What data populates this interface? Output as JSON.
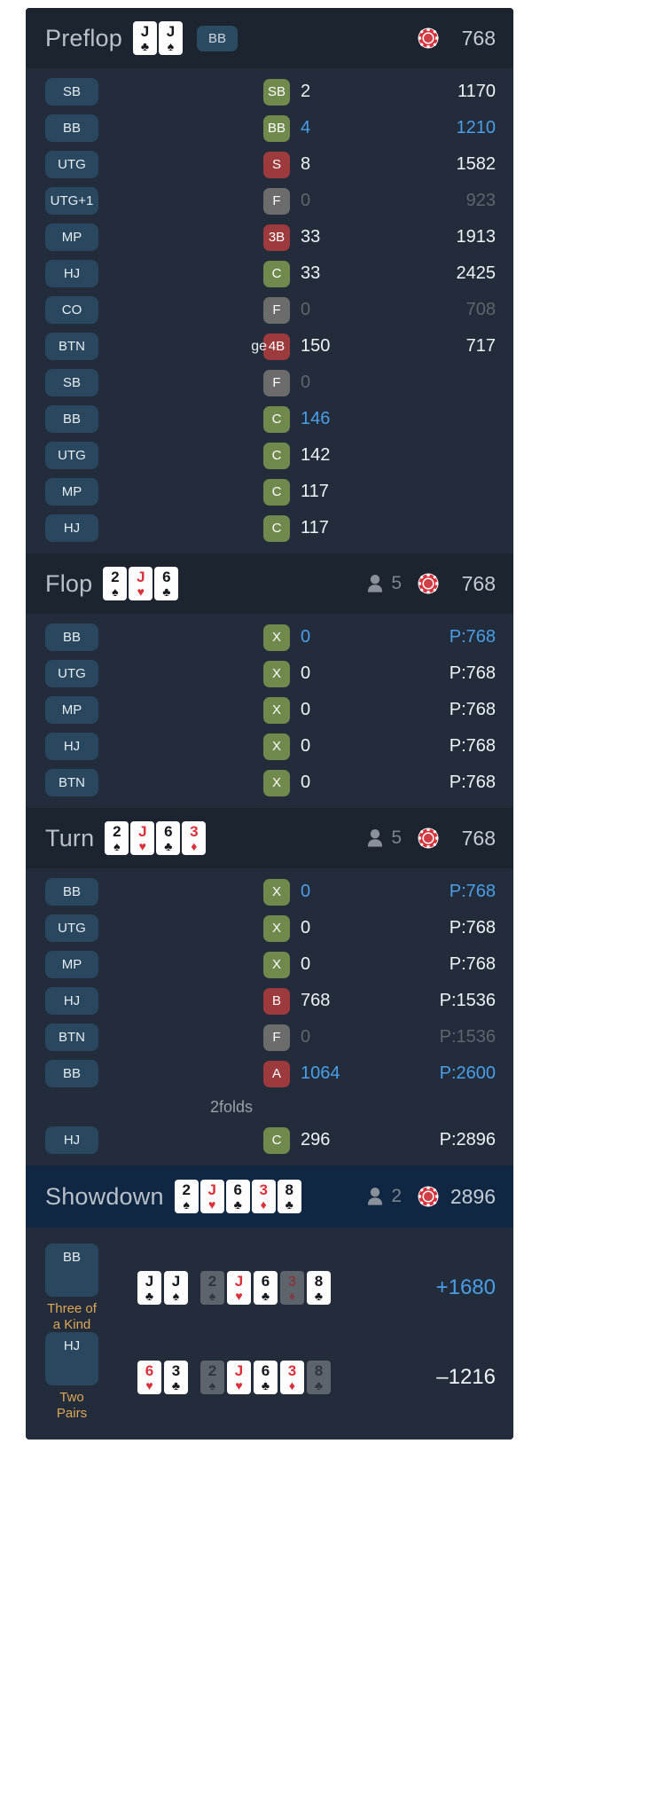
{
  "icons": {
    "chip": "poker-chip-icon",
    "person": "person-icon"
  },
  "streets": [
    {
      "id": "preflop",
      "title": "Preflop",
      "cards": [
        {
          "rank": "J",
          "suit": "♣",
          "color": "black"
        },
        {
          "rank": "J",
          "suit": "♠",
          "color": "black"
        }
      ],
      "hero_tag": "BB",
      "players": null,
      "pot": "768",
      "actions": [
        {
          "pos": "SB",
          "note": "",
          "act": "SB",
          "act_type": "call",
          "amount": "2",
          "stack": "1170",
          "hero": false,
          "folded": false
        },
        {
          "pos": "BB",
          "note": "",
          "act": "BB",
          "act_type": "call",
          "amount": "4",
          "stack": "1210",
          "hero": true,
          "folded": false
        },
        {
          "pos": "UTG",
          "note": "",
          "act": "S",
          "act_type": "raise",
          "amount": "8",
          "stack": "1582",
          "hero": false,
          "folded": false
        },
        {
          "pos": "UTG+1",
          "note": "",
          "act": "F",
          "act_type": "fold",
          "amount": "0",
          "stack": "923",
          "hero": false,
          "folded": true
        },
        {
          "pos": "MP",
          "note": "",
          "act": "3B",
          "act_type": "raise",
          "amount": "33",
          "stack": "1913",
          "hero": false,
          "folded": false
        },
        {
          "pos": "HJ",
          "note": "",
          "act": "C",
          "act_type": "call",
          "amount": "33",
          "stack": "2425",
          "hero": false,
          "folded": false
        },
        {
          "pos": "CO",
          "note": "",
          "act": "F",
          "act_type": "fold",
          "amount": "0",
          "stack": "708",
          "hero": false,
          "folded": true
        },
        {
          "pos": "BTN",
          "note": "ge",
          "act": "4B",
          "act_type": "raise",
          "amount": "150",
          "stack": "717",
          "hero": false,
          "folded": false
        },
        {
          "pos": "SB",
          "note": "",
          "act": "F",
          "act_type": "fold",
          "amount": "0",
          "stack": "",
          "hero": false,
          "folded": true
        },
        {
          "pos": "BB",
          "note": "",
          "act": "C",
          "act_type": "call",
          "amount": "146",
          "stack": "",
          "hero": true,
          "folded": false
        },
        {
          "pos": "UTG",
          "note": "",
          "act": "C",
          "act_type": "call",
          "amount": "142",
          "stack": "",
          "hero": false,
          "folded": false
        },
        {
          "pos": "MP",
          "note": "",
          "act": "C",
          "act_type": "call",
          "amount": "117",
          "stack": "",
          "hero": false,
          "folded": false
        },
        {
          "pos": "HJ",
          "note": "",
          "act": "C",
          "act_type": "call",
          "amount": "117",
          "stack": "",
          "hero": false,
          "folded": false
        }
      ],
      "folds_note": ""
    },
    {
      "id": "flop",
      "title": "Flop",
      "cards": [
        {
          "rank": "2",
          "suit": "♠",
          "color": "black"
        },
        {
          "rank": "J",
          "suit": "♥",
          "color": "red"
        },
        {
          "rank": "6",
          "suit": "♣",
          "color": "black"
        }
      ],
      "hero_tag": "",
      "players": "5",
      "pot": "768",
      "actions": [
        {
          "pos": "BB",
          "note": "",
          "act": "X",
          "act_type": "call",
          "amount": "0",
          "stack": "P:768",
          "hero": true,
          "folded": false
        },
        {
          "pos": "UTG",
          "note": "",
          "act": "X",
          "act_type": "call",
          "amount": "0",
          "stack": "P:768",
          "hero": false,
          "folded": false
        },
        {
          "pos": "MP",
          "note": "",
          "act": "X",
          "act_type": "call",
          "amount": "0",
          "stack": "P:768",
          "hero": false,
          "folded": false
        },
        {
          "pos": "HJ",
          "note": "",
          "act": "X",
          "act_type": "call",
          "amount": "0",
          "stack": "P:768",
          "hero": false,
          "folded": false
        },
        {
          "pos": "BTN",
          "note": "",
          "act": "X",
          "act_type": "call",
          "amount": "0",
          "stack": "P:768",
          "hero": false,
          "folded": false
        }
      ],
      "folds_note": ""
    },
    {
      "id": "turn",
      "title": "Turn",
      "cards": [
        {
          "rank": "2",
          "suit": "♠",
          "color": "black"
        },
        {
          "rank": "J",
          "suit": "♥",
          "color": "red"
        },
        {
          "rank": "6",
          "suit": "♣",
          "color": "black"
        },
        {
          "rank": "3",
          "suit": "♦",
          "color": "red"
        }
      ],
      "hero_tag": "",
      "players": "5",
      "pot": "768",
      "actions": [
        {
          "pos": "BB",
          "note": "",
          "act": "X",
          "act_type": "call",
          "amount": "0",
          "stack": "P:768",
          "hero": true,
          "folded": false
        },
        {
          "pos": "UTG",
          "note": "",
          "act": "X",
          "act_type": "call",
          "amount": "0",
          "stack": "P:768",
          "hero": false,
          "folded": false
        },
        {
          "pos": "MP",
          "note": "",
          "act": "X",
          "act_type": "call",
          "amount": "0",
          "stack": "P:768",
          "hero": false,
          "folded": false
        },
        {
          "pos": "HJ",
          "note": "",
          "act": "B",
          "act_type": "raise",
          "amount": "768",
          "stack": "P:1536",
          "hero": false,
          "folded": false
        },
        {
          "pos": "BTN",
          "note": "",
          "act": "F",
          "act_type": "fold",
          "amount": "0",
          "stack": "P:1536",
          "hero": false,
          "folded": true
        },
        {
          "pos": "BB",
          "note": "",
          "act": "A",
          "act_type": "raise",
          "amount": "1064",
          "stack": "P:2600",
          "hero": true,
          "folded": false
        }
      ],
      "folds_note": "2folds",
      "actions_after_note": [
        {
          "pos": "HJ",
          "note": "",
          "act": "C",
          "act_type": "call",
          "amount": "296",
          "stack": "P:2896",
          "hero": false,
          "folded": false
        }
      ]
    },
    {
      "id": "showdown",
      "title": "Showdown",
      "cards": [
        {
          "rank": "2",
          "suit": "♠",
          "color": "black"
        },
        {
          "rank": "J",
          "suit": "♥",
          "color": "red"
        },
        {
          "rank": "6",
          "suit": "♣",
          "color": "black"
        },
        {
          "rank": "3",
          "suit": "♦",
          "color": "red"
        },
        {
          "rank": "8",
          "suit": "♣",
          "color": "black"
        }
      ],
      "hero_tag": "",
      "players": "2",
      "pot": "2896",
      "actions": [],
      "folds_note": ""
    }
  ],
  "results": [
    {
      "pos": "BB",
      "hand_rank": "Three of a Kind",
      "hole": [
        {
          "rank": "J",
          "suit": "♣",
          "color": "black",
          "dim": false
        },
        {
          "rank": "J",
          "suit": "♠",
          "color": "black",
          "dim": false
        }
      ],
      "board": [
        {
          "rank": "2",
          "suit": "♠",
          "color": "black",
          "dim": true
        },
        {
          "rank": "J",
          "suit": "♥",
          "color": "red",
          "dim": false
        },
        {
          "rank": "6",
          "suit": "♣",
          "color": "black",
          "dim": false
        },
        {
          "rank": "3",
          "suit": "♦",
          "color": "red",
          "dim": true
        },
        {
          "rank": "8",
          "suit": "♣",
          "color": "black",
          "dim": false
        }
      ],
      "amount": "+1680",
      "won": true
    },
    {
      "pos": "HJ",
      "hand_rank": "Two Pairs",
      "hole": [
        {
          "rank": "6",
          "suit": "♥",
          "color": "red",
          "dim": false
        },
        {
          "rank": "3",
          "suit": "♣",
          "color": "black",
          "dim": false
        }
      ],
      "board": [
        {
          "rank": "2",
          "suit": "♠",
          "color": "black",
          "dim": true
        },
        {
          "rank": "J",
          "suit": "♥",
          "color": "red",
          "dim": false
        },
        {
          "rank": "6",
          "suit": "♣",
          "color": "black",
          "dim": false
        },
        {
          "rank": "3",
          "suit": "♦",
          "color": "red",
          "dim": false
        },
        {
          "rank": "8",
          "suit": "♣",
          "color": "black",
          "dim": true
        }
      ],
      "amount": "–1216",
      "won": false
    }
  ],
  "colors": {
    "panel_bg": "#222c3a",
    "street_head_bg": "#1c2430",
    "showdown_head_bg": "#0f2743",
    "pos_tag_bg": "#29475e",
    "call_bg": "#6f8a4c",
    "raise_bg": "#9c3a3d",
    "fold_bg": "#6c6c6c",
    "hero_text": "#4a9fe8",
    "rank_text": "#e0a857",
    "chip_red": "#d9303a"
  }
}
